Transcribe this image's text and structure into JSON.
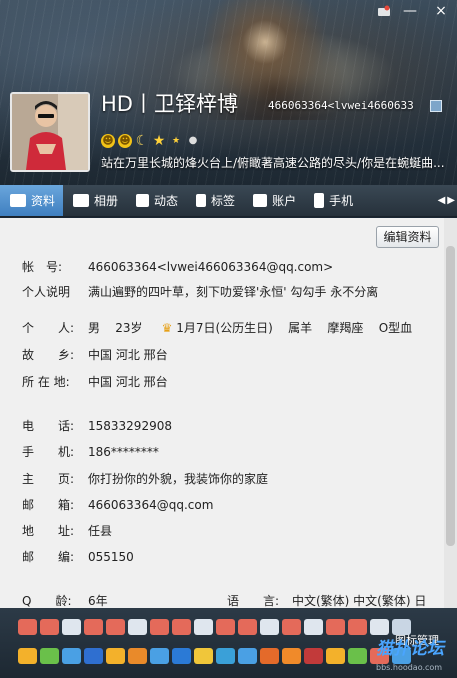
{
  "window": {
    "minimize": "—",
    "close": "×"
  },
  "profile": {
    "nickname": "HD丨卫铎梓博",
    "qq_account": "466063364<lvwei4660633",
    "signature": "站在万里长城的烽火台上/俯瞰著高速公路的尽头/你是在蜿蜒曲..."
  },
  "tabs": [
    {
      "label": "资料",
      "icon": "profile-card-icon",
      "active": true
    },
    {
      "label": "相册",
      "icon": "photo-icon",
      "active": false
    },
    {
      "label": "动态",
      "icon": "feed-icon",
      "active": false
    },
    {
      "label": "标签",
      "icon": "tag-icon",
      "active": false
    },
    {
      "label": "账户",
      "icon": "wallet-icon",
      "active": false
    },
    {
      "label": "手机",
      "icon": "phone-icon",
      "active": false
    }
  ],
  "edit_button": "编辑资料",
  "fields": {
    "account_label": "帐　号:",
    "account_value": "466063364<lvwei466063364@qq.com>",
    "bio_label": "个人说明",
    "bio_value": "满山遍野的四叶草，刻下叻爱铎'永恒' 勾勾手  永不分离",
    "person_label": "个　　人:",
    "gender": "男",
    "age": "23岁",
    "birthday": "1月7日(公历生日)",
    "zodiac": "属羊",
    "constellation": "摩羯座",
    "blood": "O型血",
    "hometown_label": "故　　乡:",
    "hometown_value": "中国 河北 邢台",
    "location_label": "所 在 地:",
    "location_value": "中国 河北 邢台",
    "phone_label": "电　　话:",
    "phone_value": "15833292908",
    "mobile_label": "手　　机:",
    "mobile_value": "186********",
    "homepage_label": "主　　页:",
    "homepage_value": "你打扮你的外貌，我装饰你的家庭",
    "email_label": "邮　　箱:",
    "email_value": "466063364@qq.com",
    "address_label": "地　　址:",
    "address_value": "任县",
    "zip_label": "邮　　编:",
    "zip_value": "055150",
    "qage_label": "Q　　龄:",
    "qage_value": "6年",
    "lang_label": "语　　言:",
    "lang_value": "中文(繁体) 中文(繁体) 日"
  },
  "iconbar": {
    "manage_label": "图标管理",
    "watermark": "猫扑论坛",
    "watermark_url": "bbs.hoodao.com"
  }
}
